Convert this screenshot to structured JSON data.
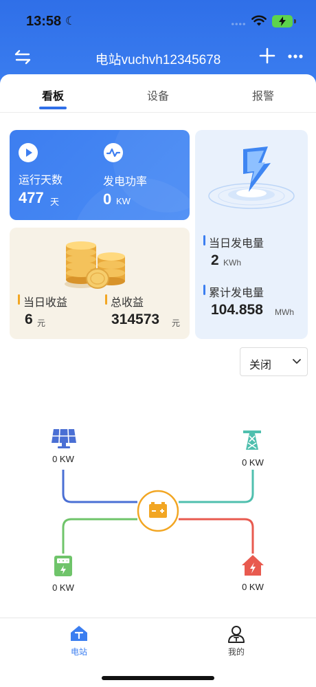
{
  "status_bar": {
    "time": "13:58"
  },
  "nav": {
    "title": "电站vuchvh12345678"
  },
  "tabs": [
    {
      "label": "看板",
      "active": true
    },
    {
      "label": "设备",
      "active": false
    },
    {
      "label": "报警",
      "active": false
    }
  ],
  "summary": {
    "run_days": {
      "label": "运行天数",
      "value": "477",
      "unit": "天"
    },
    "power": {
      "label": "发电功率",
      "value": "0",
      "unit": "KW"
    },
    "daily_income": {
      "label": "当日收益",
      "value": "6",
      "unit": "元"
    },
    "total_income": {
      "label": "总收益",
      "value": "314573",
      "unit": "元"
    },
    "daily_gen": {
      "label": "当日发电量",
      "value": "2",
      "unit": "KWh"
    },
    "total_gen": {
      "label": "累计发电量",
      "value": "104.858",
      "unit": "MWh"
    }
  },
  "dropdown": {
    "selected": "关闭"
  },
  "flow": {
    "solar": "0 KW",
    "grid": "0 KW",
    "meter": "0 KW",
    "home": "0 KW"
  },
  "colors": {
    "primary": "#2f6fe8",
    "solar_line": "#4a6fd4",
    "grid_line": "#4fbfae",
    "meter_line": "#6fc46a",
    "home_line": "#e85a4f",
    "battery": "#f2a623"
  },
  "tabbar": [
    {
      "label": "电站",
      "active": true
    },
    {
      "label": "我的",
      "active": false
    }
  ]
}
